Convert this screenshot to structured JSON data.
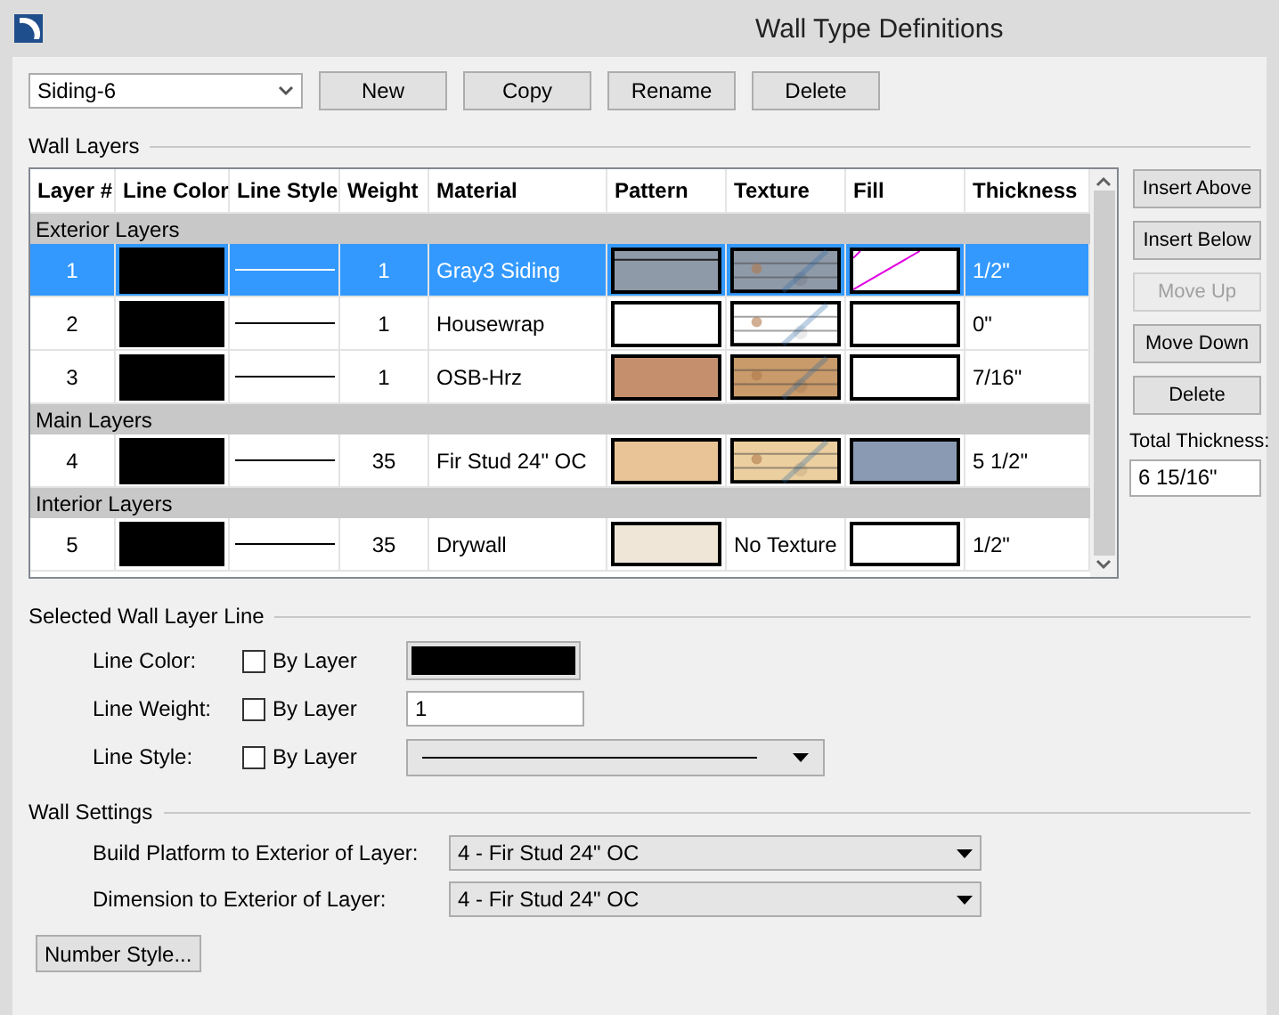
{
  "window": {
    "title": "Wall Type Definitions"
  },
  "toolbar": {
    "wall_type": "Siding-6",
    "buttons": [
      "New",
      "Copy",
      "Rename",
      "Delete"
    ]
  },
  "wall_layers": {
    "title": "Wall Layers",
    "columns": [
      "Layer #",
      "Line Color",
      "Line Style",
      "Weight",
      "Material",
      "Pattern",
      "Texture",
      "Fill",
      "Thickness"
    ],
    "rows": [
      {
        "kind": "group",
        "label": "Exterior Layers"
      },
      {
        "kind": "layer",
        "selected": true,
        "number": "1",
        "line_color": {
          "color": "#000000"
        },
        "weight": "1",
        "material": "Gray3 Siding",
        "pattern": {
          "color": "#8f9aa8"
        },
        "fill": {
          "color": "#ffffff",
          "hatched": true
        },
        "thickness": "1/2\""
      },
      {
        "kind": "layer",
        "selected": false,
        "number": "2",
        "line_color": {
          "color": "#000000"
        },
        "weight": "1",
        "material": "Housewrap",
        "pattern": {
          "color": "#ffffff"
        },
        "fill": {
          "color": "#ffffff",
          "hatched": false
        },
        "thickness": "0\""
      },
      {
        "kind": "layer",
        "selected": false,
        "number": "3",
        "line_color": {
          "color": "#000000"
        },
        "weight": "1",
        "material": "OSB-Hrz",
        "pattern": {
          "color": "#c58f6e"
        },
        "fill": {
          "color": "#ffffff",
          "hatched": false
        },
        "thickness": "7/16\""
      },
      {
        "kind": "group",
        "label": "Main Layers"
      },
      {
        "kind": "layer",
        "selected": false,
        "number": "4",
        "line_color": {
          "color": "#000000"
        },
        "weight": "35",
        "material": "Fir Stud 24\" OC",
        "pattern": {
          "color": "#e8c497"
        },
        "fill": {
          "color": "#8a9ab2",
          "hatched": false
        },
        "thickness": "5 1/2\""
      },
      {
        "kind": "group",
        "label": "Interior Layers"
      },
      {
        "kind": "layer",
        "selected": false,
        "number": "5",
        "line_color": {
          "color": "#000000"
        },
        "weight": "35",
        "material": "Drywall",
        "pattern": {
          "color": "#efe6d8"
        },
        "texture": {
          "kind": "text",
          "label": "No Texture"
        },
        "fill": {
          "color": "#ffffff",
          "hatched": false
        },
        "thickness": "1/2\""
      }
    ],
    "side_buttons": [
      {
        "label": "Insert Above",
        "disabled": false
      },
      {
        "label": "Insert Below",
        "disabled": false
      },
      {
        "label": "Move Up",
        "disabled": true
      },
      {
        "label": "Move Down",
        "disabled": false
      },
      {
        "label": "Delete",
        "disabled": false
      }
    ],
    "total_thickness": {
      "label": "Total Thickness:",
      "value": "6 15/16\""
    }
  },
  "selected_line": {
    "title": "Selected Wall Layer Line",
    "rows": [
      {
        "kind": "color",
        "label": "Line Color:",
        "by_layer": "By Layer",
        "checked": false,
        "color": "#000000"
      },
      {
        "kind": "weight",
        "label": "Line Weight:",
        "by_layer": "By Layer",
        "checked": false,
        "value": "1"
      },
      {
        "kind": "style",
        "label": "Line Style:",
        "by_layer": "By Layer",
        "checked": false
      }
    ]
  },
  "wall_settings": {
    "title": "Wall Settings",
    "rows": [
      {
        "label": "Build Platform to Exterior of Layer:",
        "value": "4 - Fir Stud 24\" OC"
      },
      {
        "label": "Dimension to Exterior of Layer:",
        "value": "4 - Fir Stud 24\" OC"
      }
    ]
  },
  "number_style_button": "Number Style..."
}
